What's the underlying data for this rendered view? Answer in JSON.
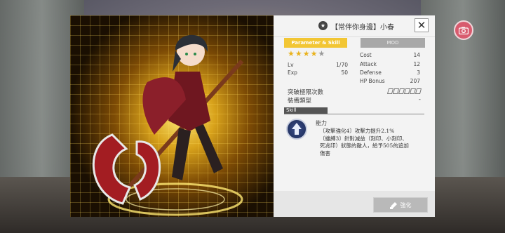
{
  "card": {
    "name": "【常伴你身邊】小春"
  },
  "tabs": {
    "parameter_skill": "Parameter & Skill",
    "mod": "MOD"
  },
  "stars": {
    "filled": 4,
    "total": 5
  },
  "stats_left": [
    {
      "label": "Lv",
      "value": "1/70"
    },
    {
      "label": "Exp",
      "value": "50"
    }
  ],
  "stats_right": [
    {
      "label": "Cost",
      "value": "14"
    },
    {
      "label": "Attack",
      "value": "12"
    },
    {
      "label": "Defense",
      "value": "3"
    },
    {
      "label": "HP Bonus",
      "value": "207"
    }
  ],
  "limit_break": {
    "label": "突破極限次數",
    "filled": 0,
    "total": 6
  },
  "equip_type": {
    "label": "裝備類型",
    "value": "-"
  },
  "skill": {
    "section_label": "Skill",
    "name": "能力",
    "description_lines": [
      "〔攻擊強化4〕攻擊力提升2.1%",
      "〔纏縛3〕針對減益（刻印、小刻印、",
      "死兆印）狀態的敵人，給予505的追加",
      "傷害"
    ]
  },
  "enhance_button": "強化",
  "colors": {
    "tab_active": "#f2c634",
    "tab_inactive": "#a8a8a8",
    "camera_button": "#d85b6e",
    "star": "#e9b21c"
  }
}
